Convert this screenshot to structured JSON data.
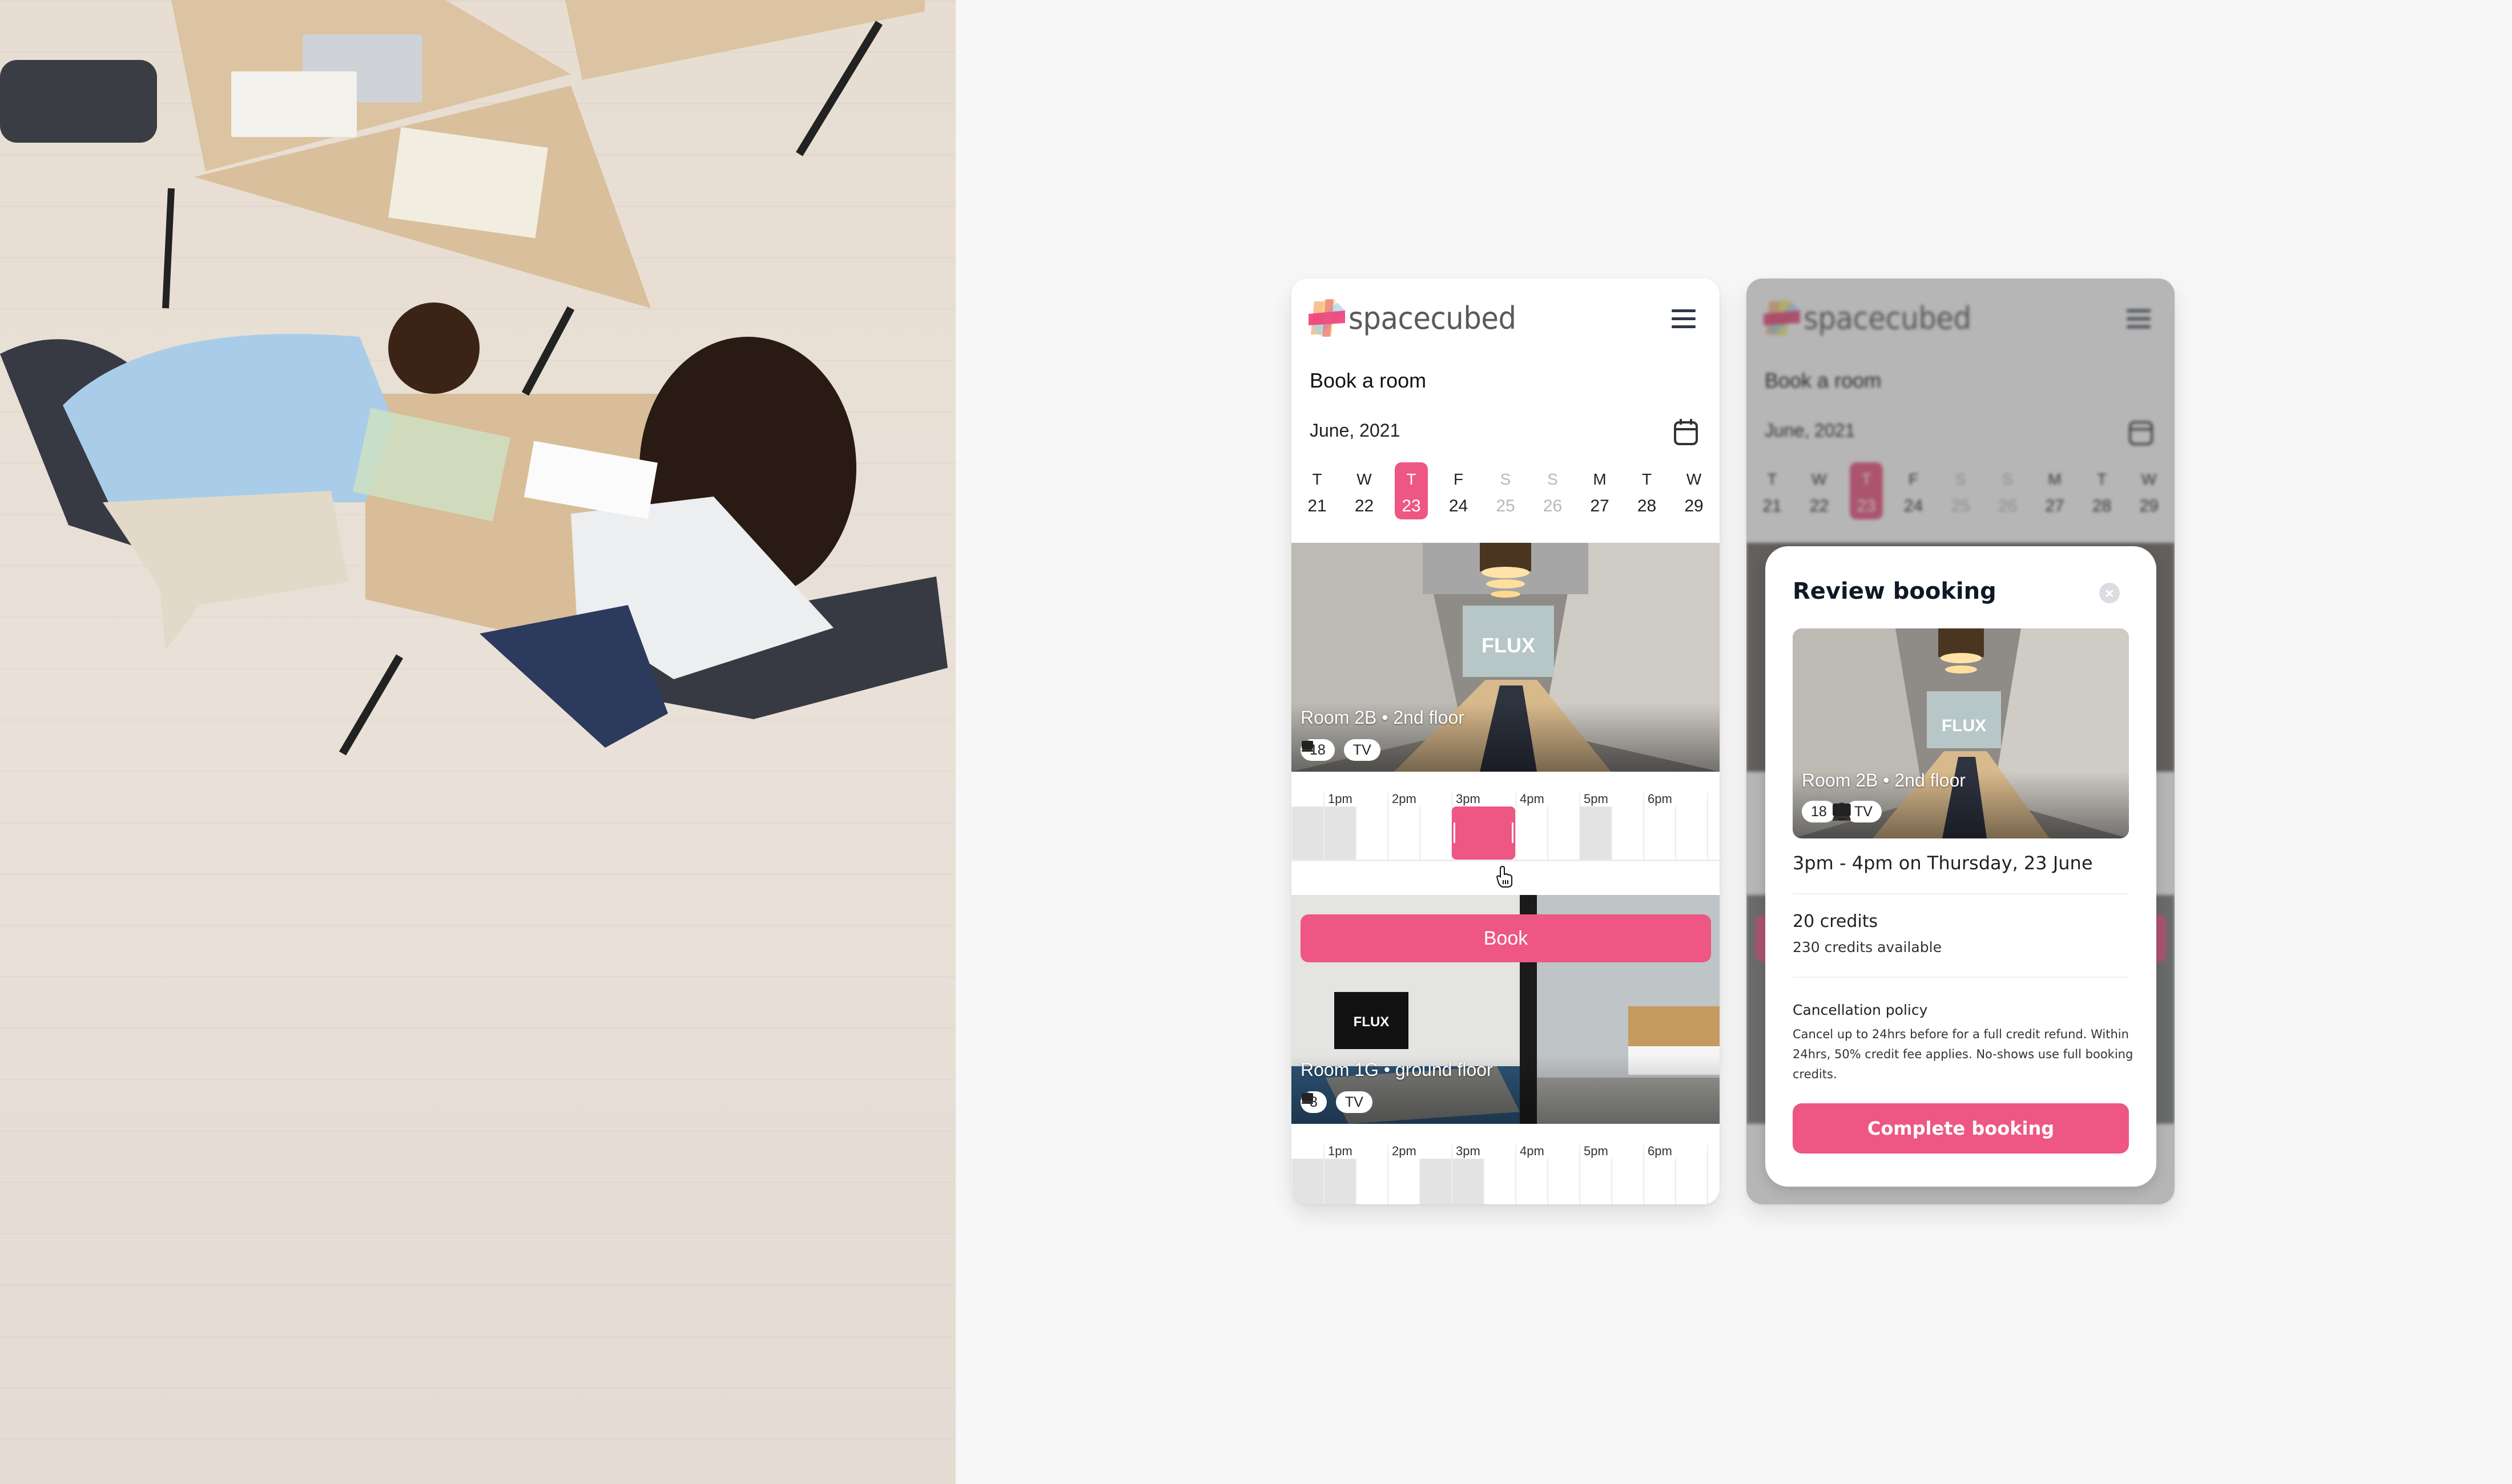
{
  "brand": {
    "name": "spacecubed",
    "accent": "#ee5783"
  },
  "header": {
    "menu_icon": "hamburger-menu-icon"
  },
  "page": {
    "title": "Book a room"
  },
  "calendar": {
    "month": "June, 2021",
    "icon": "calendar-icon",
    "days": [
      {
        "letter": "T",
        "number": "21",
        "state": "normal"
      },
      {
        "letter": "W",
        "number": "22",
        "state": "normal"
      },
      {
        "letter": "T",
        "number": "23",
        "state": "selected"
      },
      {
        "letter": "F",
        "number": "24",
        "state": "normal"
      },
      {
        "letter": "S",
        "number": "25",
        "state": "weekend"
      },
      {
        "letter": "S",
        "number": "26",
        "state": "weekend"
      },
      {
        "letter": "M",
        "number": "27",
        "state": "normal"
      },
      {
        "letter": "T",
        "number": "28",
        "state": "normal"
      },
      {
        "letter": "W",
        "number": "29",
        "state": "normal"
      }
    ]
  },
  "timeline_hours": [
    "1pm",
    "2pm",
    "3pm",
    "4pm",
    "5pm",
    "6pm"
  ],
  "rooms": [
    {
      "name": "Room 2B • 2nd floor",
      "capacity": "18",
      "amenity": "TV",
      "busy_half_hours": [
        "12:30pm",
        "1pm",
        "5pm"
      ],
      "selected": {
        "start": "3pm",
        "end": "4pm"
      }
    },
    {
      "name": "Room 1G • ground floor",
      "capacity": "8",
      "amenity": "TV",
      "busy_half_hours": [
        "12:30pm",
        "1pm",
        "2:30pm",
        "3pm"
      ],
      "selected": null
    }
  ],
  "book_button": "Book",
  "review": {
    "title": "Review booking",
    "close_icon": "close-icon",
    "room_name": "Room 2B • 2nd floor",
    "capacity": "18",
    "amenity": "TV",
    "when": "3pm - 4pm on Thursday, 23 June",
    "credits": "20 credits",
    "credits_available": "230 credits available",
    "policy_title": "Cancellation policy",
    "policy_text": "Cancel up to 24hrs before for a full credit refund. Within 24hrs, 50% credit fee applies. No-shows use full booking credits.",
    "complete_button": "Complete booking"
  }
}
